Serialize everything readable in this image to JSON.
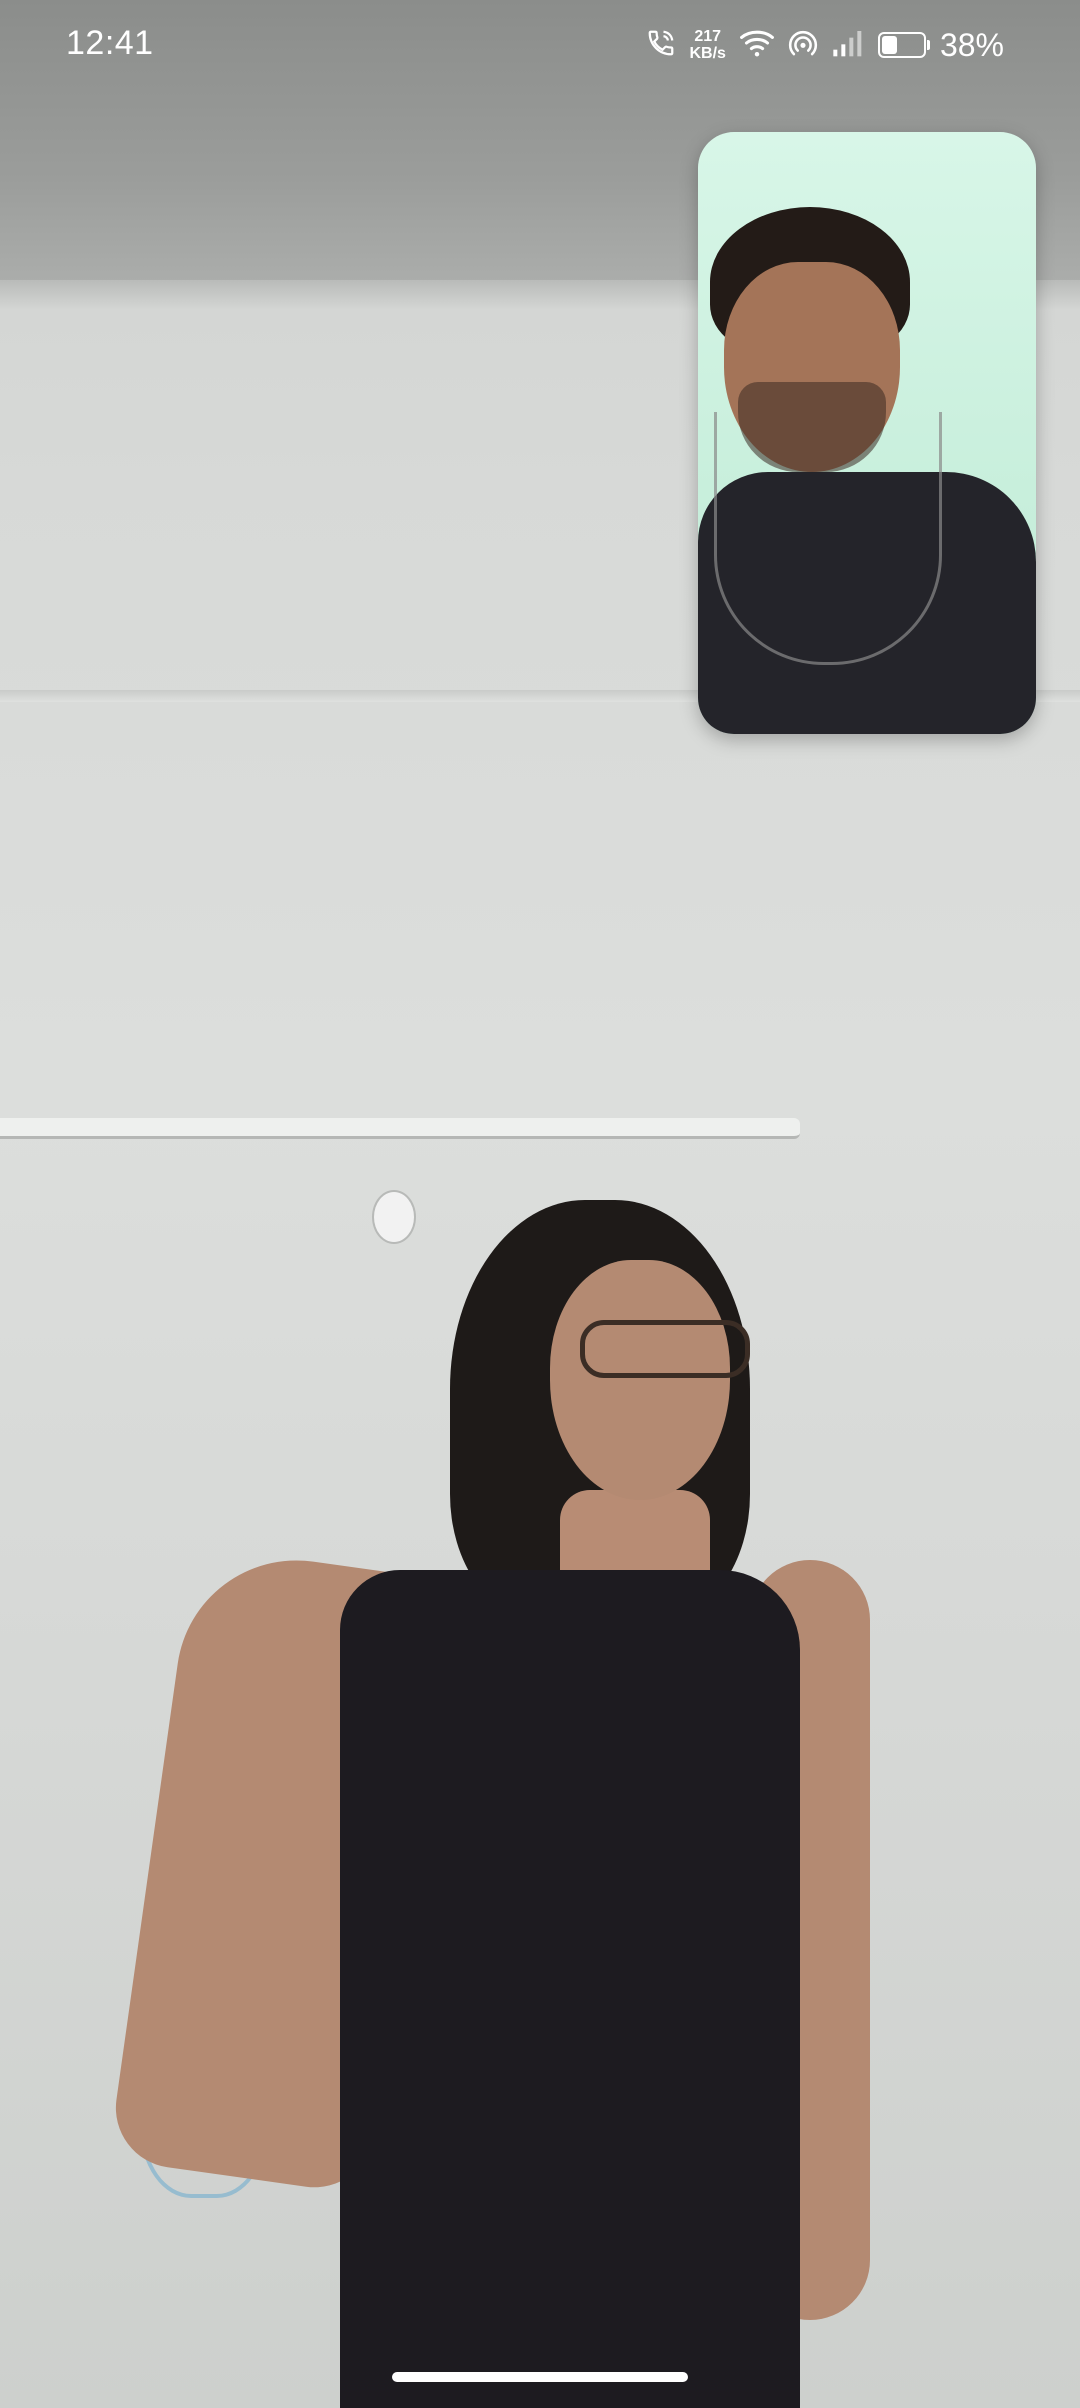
{
  "status_bar": {
    "time": "12:41",
    "net_speed_value": "217",
    "net_speed_unit": "KB/s",
    "battery_percent": "38%",
    "battery_level": 0.38,
    "icons": [
      "call-active-icon",
      "wifi-icon",
      "hotspot-icon",
      "signal-icon",
      "battery-icon"
    ]
  },
  "video_call": {
    "remote_video": "remote-participant-video",
    "self_view": "self-preview-video"
  },
  "colors": {
    "status_text": "#ffffff",
    "self_view_bg": "#d8f6e8"
  }
}
